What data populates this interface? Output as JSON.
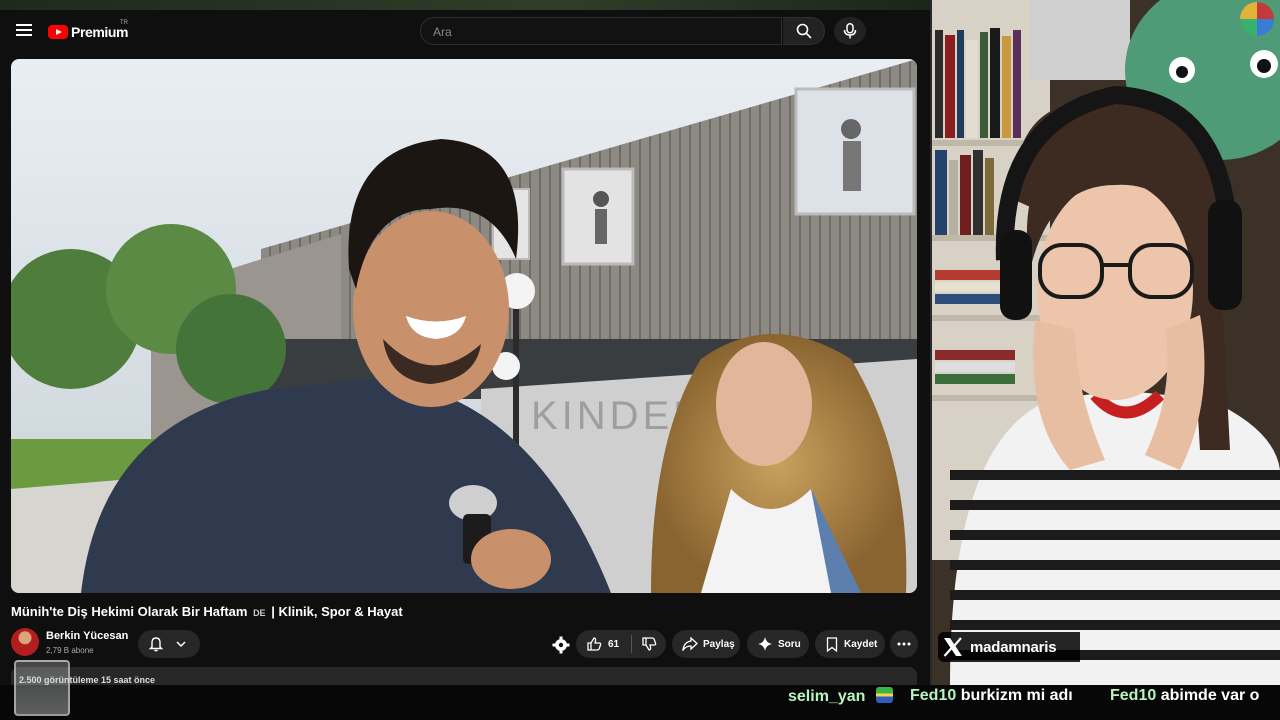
{
  "header": {
    "logo_text": "Premium",
    "country_code": "TR",
    "search_placeholder": "Ara"
  },
  "video": {
    "title_part1": "Münih'te Diş Hekimi Olarak Bir Haftam",
    "title_badge": "DE",
    "title_part2": "| Klinik, Spor & Hayat",
    "channel_name": "Berkin Yücesan",
    "subscribers": "2,79 B abone",
    "like_count": "61",
    "share_label": "Paylaş",
    "ask_label": "Soru",
    "save_label": "Kaydet",
    "meta": "2.500 görüntüleme  15 saat önce"
  },
  "webcam": {
    "x_handle": "madamnaris"
  },
  "chat": [
    {
      "user": "selim_yan",
      "message": ""
    },
    {
      "user": "Fed10",
      "message": "burkizm mi adı"
    },
    {
      "user": "Fed10",
      "message": "abimde var o"
    }
  ],
  "colors": {
    "youtube_red": "#ff0000",
    "chat_username": "#b7f5c0",
    "background": "#0f0f0f"
  }
}
